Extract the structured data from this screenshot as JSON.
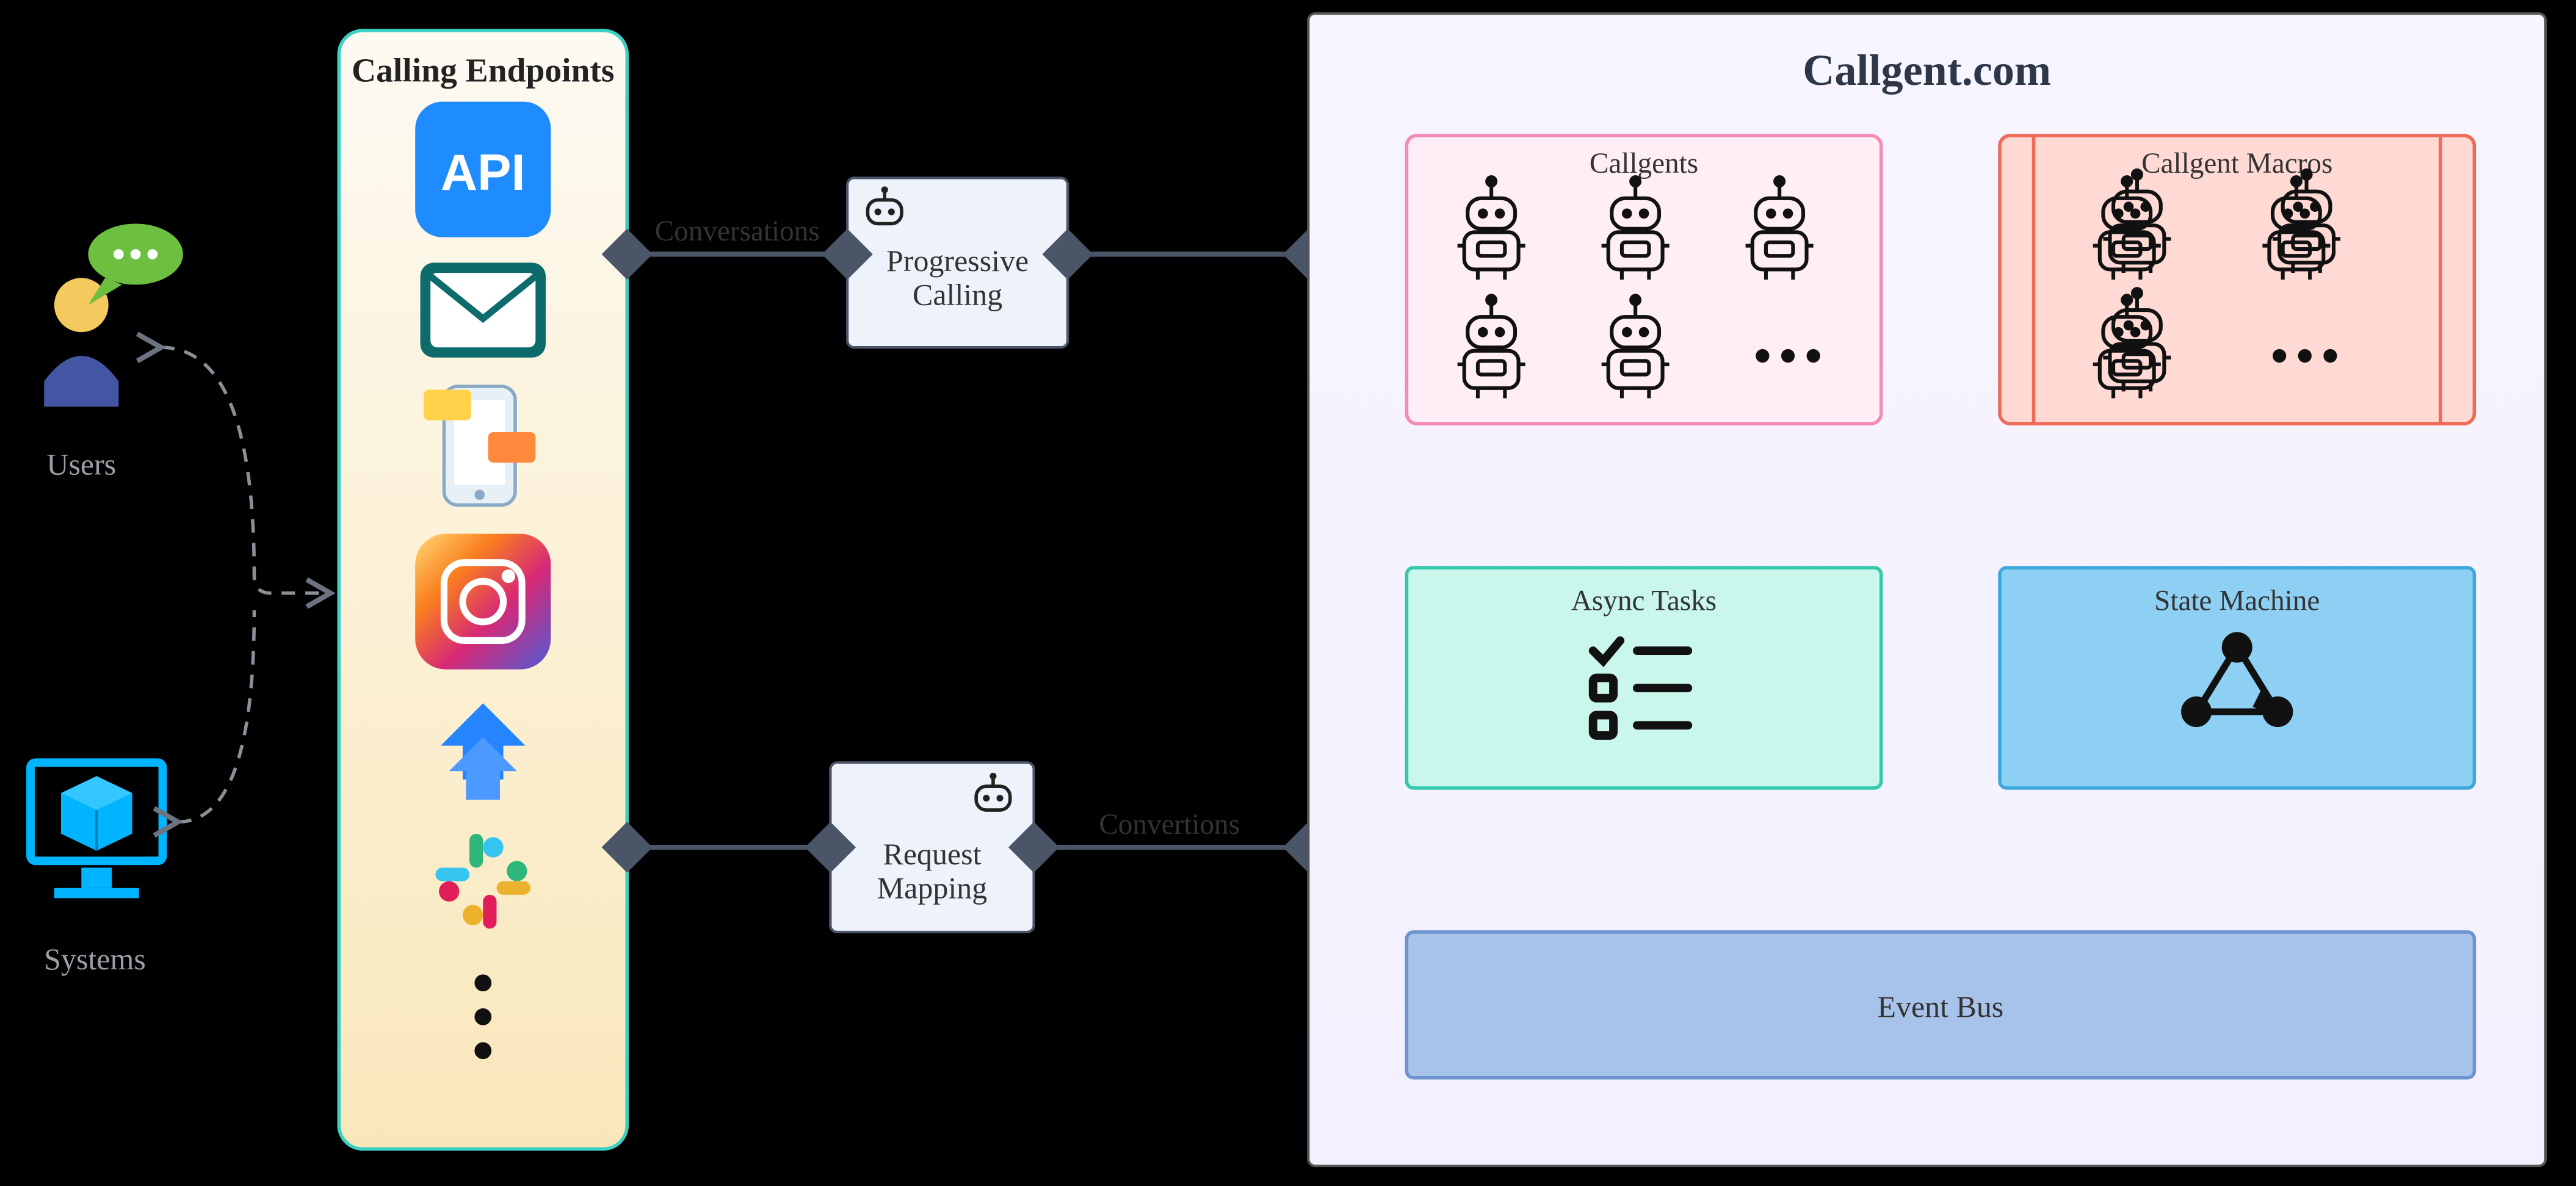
{
  "actors": {
    "users_label": "Users",
    "systems_label": "Systems"
  },
  "calling_endpoints": {
    "title": "Calling Endpoints",
    "icons": [
      "api",
      "email",
      "sms",
      "instagram",
      "jira",
      "slack",
      "more"
    ]
  },
  "connectors": {
    "conversations_label": "Conversations",
    "convertions_label": "Convertions"
  },
  "middle_boxes": {
    "progressive_calling": "Progressive\nCalling",
    "request_mapping": "Request\nMapping"
  },
  "platform": {
    "title": "Callgent.com",
    "callgents_label": "Callgents",
    "macros_label": "Callgent Macros",
    "async_tasks_label": "Async Tasks",
    "state_machine_label": "State Machine",
    "event_bus_label": "Event  Bus"
  }
}
